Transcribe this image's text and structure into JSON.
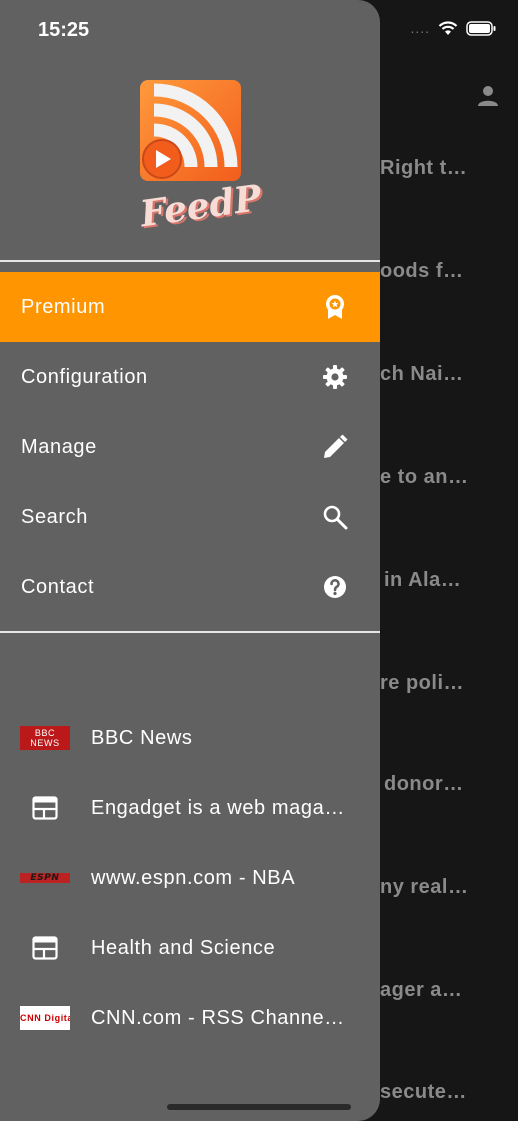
{
  "status_bar": {
    "time": "15:25",
    "cellular": "....",
    "wifi_icon": "wifi-icon",
    "battery_icon": "battery-icon"
  },
  "background": {
    "profile_icon": "person-icon",
    "rows": [
      "Right t…",
      "oods f…",
      "ch Nai…",
      "e to an…",
      "in Ala…",
      "re poli…",
      "donor…",
      "ny real…",
      "ager a…",
      "secute…"
    ]
  },
  "drawer": {
    "logo_text": "FeedP",
    "menu": [
      {
        "label": "Premium",
        "icon": "badge-icon",
        "active": true
      },
      {
        "label": "Configuration",
        "icon": "gear-icon",
        "active": false
      },
      {
        "label": "Manage",
        "icon": "pencil-icon",
        "active": false
      },
      {
        "label": "Search",
        "icon": "search-icon",
        "active": false
      },
      {
        "label": "Contact",
        "icon": "help-icon",
        "active": false
      }
    ],
    "feeds": [
      {
        "label": "BBC News",
        "icon": "bbc-news-logo",
        "logo_text": "BBC NEWS"
      },
      {
        "label": "Engadget is a web maga…",
        "icon": "newspaper-icon"
      },
      {
        "label": "www.espn.com - NBA",
        "icon": "espn-logo",
        "logo_text": "ESPN"
      },
      {
        "label": "Health and Science",
        "icon": "newspaper-icon"
      },
      {
        "label": "CNN.com - RSS Channe…",
        "icon": "cnn-logo",
        "logo_text": "CNN Digital"
      }
    ]
  },
  "colors": {
    "accent": "#ff9500",
    "drawer_bg": "#616161",
    "background": "#161616"
  }
}
